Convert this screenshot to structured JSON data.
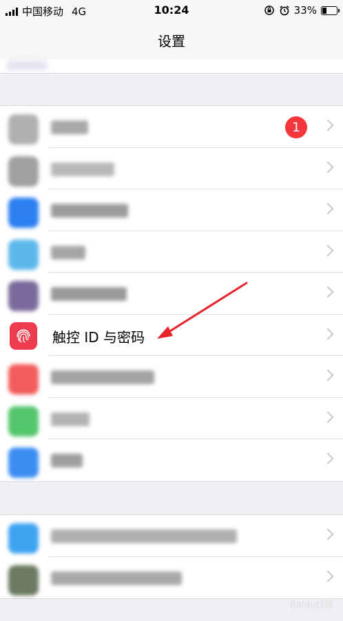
{
  "status_bar": {
    "carrier": "中国移动",
    "network": "4G",
    "time": "10:24",
    "battery_percent": "33%",
    "battery_level": 0.33
  },
  "nav": {
    "title": "设置"
  },
  "groups": [
    {
      "rows": [
        {
          "id": "account",
          "badge": "1",
          "icon_color": "#b0b0b0",
          "blur_color": "#a9a9a9"
        },
        {
          "id": "row-2",
          "icon_color": "#a0a0a0",
          "blur_color": "#b8b8b8"
        },
        {
          "id": "row-3",
          "icon_color": "#2b7ff0",
          "blur_color": "#9c9c9c"
        },
        {
          "id": "row-4",
          "icon_color": "#5cb8ea",
          "blur_color": "#a5a5a5"
        },
        {
          "id": "row-5",
          "icon_color": "#7a6b9c",
          "blur_color": "#999999"
        },
        {
          "id": "touch-id",
          "label": "触控 ID 与密码",
          "icon_color": "#ef3b4e"
        },
        {
          "id": "row-7",
          "icon_color": "#f35c5c",
          "blur_color": "#a3a3a3"
        },
        {
          "id": "row-8",
          "icon_color": "#55c66b",
          "blur_color": "#b3b3b3"
        },
        {
          "id": "row-9",
          "icon_color": "#3b8ef0",
          "blur_color": "#9f9f9f"
        }
      ]
    },
    {
      "rows": [
        {
          "id": "row-10",
          "icon_color": "#3ea3f0",
          "blur_color": "#b0b0b0"
        },
        {
          "id": "row-11",
          "icon_color": "#6c7a62",
          "blur_color": "#a9a9a9"
        }
      ]
    }
  ],
  "watermark": "Baidu经验",
  "annotation_arrow_color": "#e8232b"
}
